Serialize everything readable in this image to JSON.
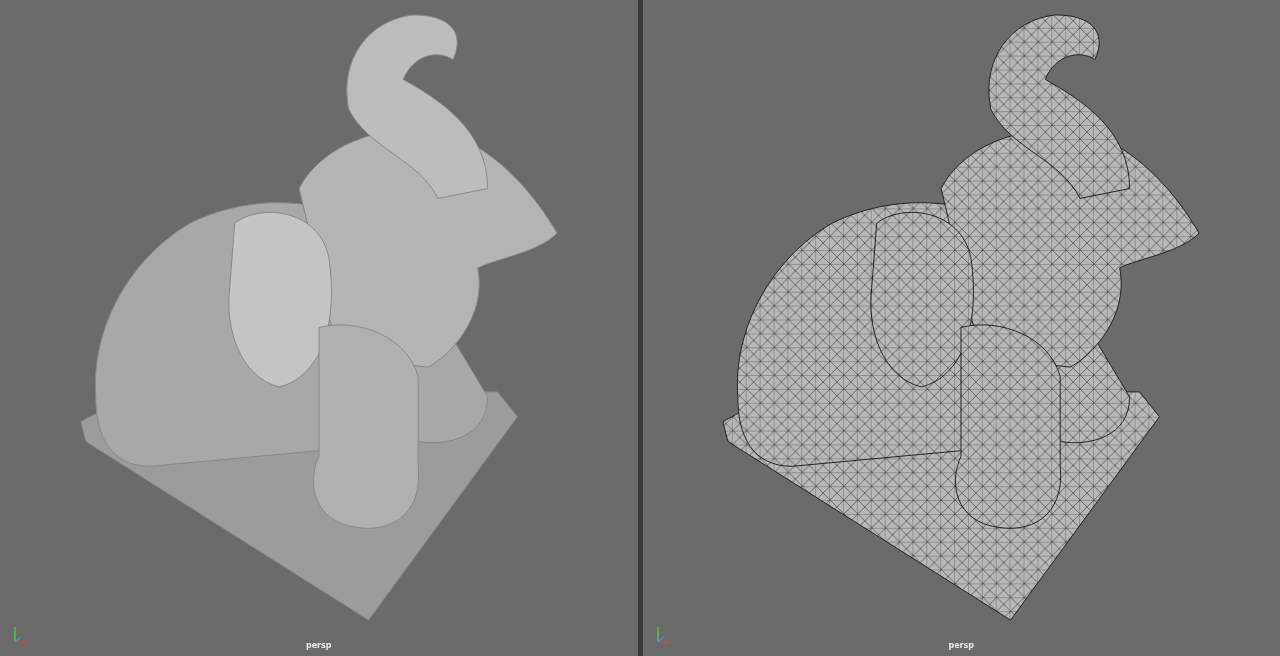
{
  "viewports": [
    {
      "kind": "shaded",
      "camera": "persp"
    },
    {
      "kind": "wireframe",
      "camera": "persp"
    }
  ]
}
